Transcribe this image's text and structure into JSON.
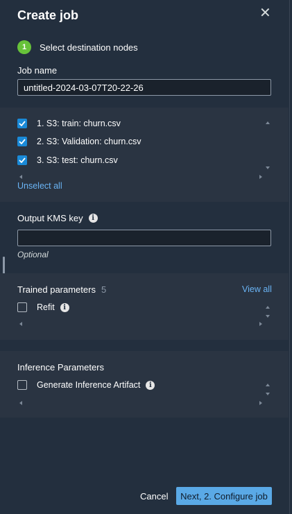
{
  "header": {
    "title": "Create job"
  },
  "step": {
    "number": "1",
    "label": "Select destination nodes"
  },
  "job_name": {
    "label": "Job name",
    "value": "untitled-2024-03-07T20-22-26"
  },
  "nodes": {
    "items": [
      {
        "label": "1. S3: train: churn.csv",
        "checked": true
      },
      {
        "label": "2. S3: Validation: churn.csv",
        "checked": true
      },
      {
        "label": "3. S3: test: churn.csv",
        "checked": true
      }
    ],
    "unselect_label": "Unselect all"
  },
  "kms": {
    "label": "Output KMS key",
    "value": "",
    "hint": "Optional"
  },
  "trained_params": {
    "label": "Trained parameters",
    "count": "5",
    "view_all_label": "View all",
    "items": [
      {
        "label": "Refit",
        "checked": false
      }
    ]
  },
  "inference_params": {
    "label": "Inference Parameters",
    "items": [
      {
        "label": "Generate Inference Artifact",
        "checked": false
      }
    ]
  },
  "footer": {
    "cancel_label": "Cancel",
    "next_label": "Next, 2. Configure job"
  },
  "colors": {
    "accent": "#5aa9e6",
    "step_badge": "#67c23a",
    "checkbox": "#1a8ad8"
  }
}
